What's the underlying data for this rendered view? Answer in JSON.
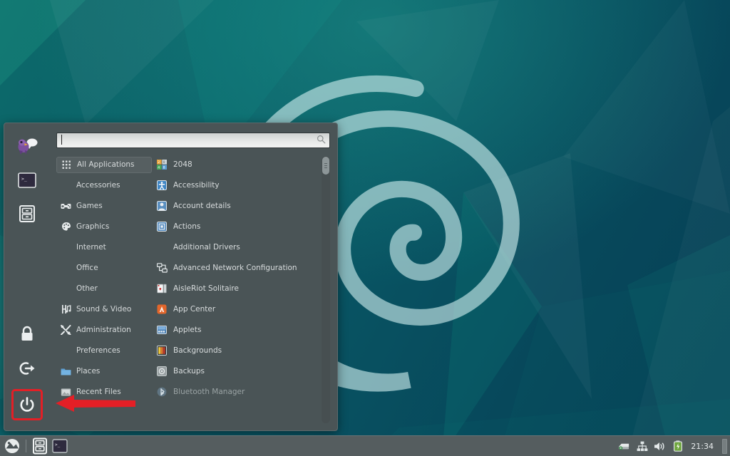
{
  "desktop": {
    "wallpaper_name": "debian-teal-polygons",
    "logo_name": "debian-swirl-logo",
    "colors": {
      "bg_dark": "#063f55",
      "bg_teal": "#0a5f68",
      "accent_green": "#15a08f"
    }
  },
  "menu": {
    "panel_name": "application-menu",
    "search": {
      "value": "",
      "placeholder": "",
      "icon": "search-icon"
    },
    "favorites": [
      {
        "name": "hexchat-icon",
        "label": "HexChat"
      },
      {
        "name": "terminal-icon",
        "label": "Terminal"
      },
      {
        "name": "file-manager-icon",
        "label": "Files"
      }
    ],
    "session_buttons": [
      {
        "name": "lock-screen-icon",
        "label": "Lock Screen",
        "highlighted": false
      },
      {
        "name": "logout-icon",
        "label": "Log Out",
        "highlighted": false
      },
      {
        "name": "power-icon",
        "label": "Quit",
        "highlighted": true
      }
    ],
    "categories": [
      {
        "label": "All Applications",
        "icon": "grid-icon",
        "selected": true
      },
      {
        "label": "Accessories",
        "icon": "",
        "selected": false
      },
      {
        "label": "Games",
        "icon": "gamepad-icon",
        "selected": false
      },
      {
        "label": "Graphics",
        "icon": "palette-icon",
        "selected": false
      },
      {
        "label": "Internet",
        "icon": "",
        "selected": false
      },
      {
        "label": "Office",
        "icon": "",
        "selected": false
      },
      {
        "label": "Other",
        "icon": "",
        "selected": false
      },
      {
        "label": "Sound & Video",
        "icon": "sound-video-icon",
        "selected": false
      },
      {
        "label": "Administration",
        "icon": "tools-icon",
        "selected": false
      },
      {
        "label": "Preferences",
        "icon": "",
        "selected": false
      },
      {
        "label": "Places",
        "icon": "folder-icon",
        "selected": false
      },
      {
        "label": "Recent Files",
        "icon": "recent-files-icon",
        "selected": false
      }
    ],
    "applications": [
      {
        "label": "2048",
        "icon": "tiles-2048-icon",
        "dim": false
      },
      {
        "label": "Accessibility",
        "icon": "accessibility-icon",
        "dim": false
      },
      {
        "label": "Account details",
        "icon": "account-details-icon",
        "dim": false
      },
      {
        "label": "Actions",
        "icon": "actions-icon",
        "dim": false
      },
      {
        "label": "Additional Drivers",
        "icon": "",
        "dim": false
      },
      {
        "label": "Advanced Network Configuration",
        "icon": "network-config-icon",
        "dim": false
      },
      {
        "label": "AisleRiot Solitaire",
        "icon": "cards-icon",
        "dim": false
      },
      {
        "label": "App Center",
        "icon": "app-center-icon",
        "dim": false
      },
      {
        "label": "Applets",
        "icon": "applets-icon",
        "dim": false
      },
      {
        "label": "Backgrounds",
        "icon": "backgrounds-icon",
        "dim": false
      },
      {
        "label": "Backups",
        "icon": "backups-icon",
        "dim": false
      },
      {
        "label": "Bluetooth Manager",
        "icon": "bluetooth-icon",
        "dim": true
      }
    ],
    "scrollbar": {
      "position": "top"
    }
  },
  "annotation": {
    "arrow_name": "red-pointer-arrow",
    "highlight_color": "#e41f26",
    "target": "power-icon"
  },
  "taskbar": {
    "launchers": [
      {
        "name": "menu-button-icon",
        "label": "Menu"
      }
    ],
    "windows": [
      {
        "name": "file-manager-task-icon",
        "label": "Files"
      },
      {
        "name": "terminal-task-icon",
        "label": "Terminal"
      }
    ],
    "tray": [
      {
        "name": "removable-media-icon",
        "label": "Removable media"
      },
      {
        "name": "network-icon",
        "label": "Network"
      },
      {
        "name": "volume-icon",
        "label": "Volume"
      },
      {
        "name": "battery-icon",
        "label": "Battery"
      }
    ],
    "clock": "21:34"
  }
}
